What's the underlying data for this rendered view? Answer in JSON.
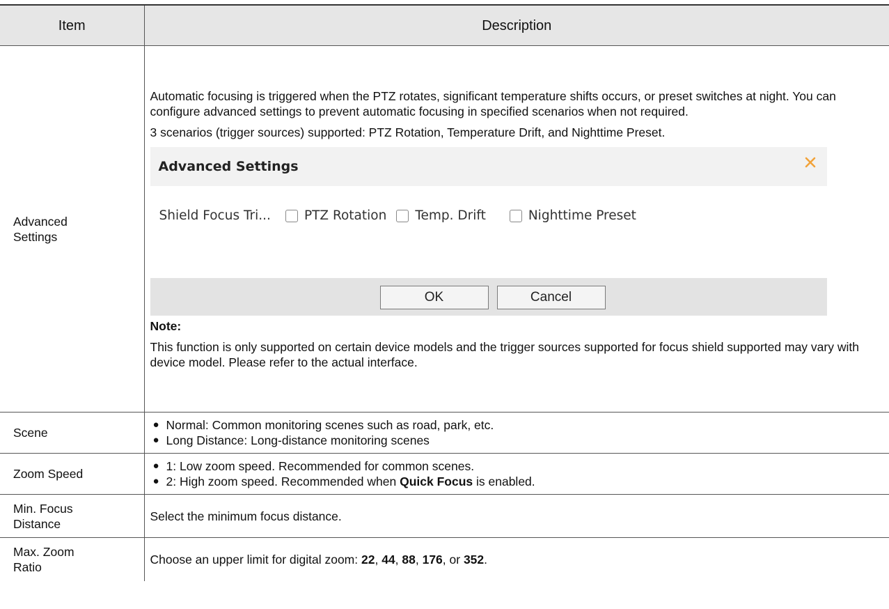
{
  "header": {
    "item": "Item",
    "description": "Description"
  },
  "rows": {
    "advanced": {
      "item_line1": "Advanced",
      "item_line2": "Settings",
      "p1": "Automatic focusing is triggered when the PTZ rotates, significant temperature shifts occurs, or preset switches at night. You can configure advanced settings to prevent automatic focusing in specified scenarios when not required.",
      "p2": "3 scenarios (trigger sources) supported: PTZ Rotation, Temperature Drift, and Nighttime Preset.",
      "dialog": {
        "title": "Advanced Settings",
        "label": "Shield Focus Tri...",
        "options": [
          "PTZ Rotation",
          "Temp. Drift",
          "Nighttime Preset"
        ],
        "ok": "OK",
        "cancel": "Cancel",
        "close_icon": "close-icon",
        "accent": "#f2a33a"
      },
      "note_title": "Note:",
      "note_text": "This function is only supported on certain device models and the trigger sources supported for focus shield supported may vary with device model. Please refer to the actual interface."
    },
    "scene": {
      "item": "Scene",
      "bullets": [
        "Normal: Common monitoring scenes such as road, park, etc.",
        "Long Distance: Long-distance monitoring scenes"
      ]
    },
    "zoom_speed": {
      "item": "Zoom Speed",
      "b1": "1: Low zoom speed. Recommended for common scenes.",
      "b2_pre": "2: High zoom speed. Recommended when ",
      "b2_bold": "Quick Focus",
      "b2_post": " is enabled."
    },
    "min_focus": {
      "item_line1": "Min. Focus",
      "item_line2": "Distance",
      "text": "Select the minimum focus distance."
    },
    "max_zoom": {
      "item_line1": "Max. Zoom",
      "item_line2": "Ratio",
      "pre": "Choose an upper limit for digital zoom: ",
      "v1": "22",
      "v2": "44",
      "v3": "88",
      "v4": "176",
      "v5": "352",
      "sep": ", ",
      "or": ", or ",
      "end": "."
    }
  },
  "bullet_char": "●"
}
